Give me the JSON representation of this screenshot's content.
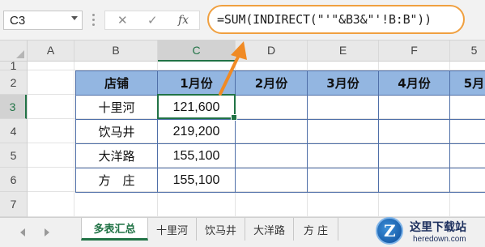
{
  "formula_bar": {
    "name_box": "C3",
    "cancel_icon": "✕",
    "enter_icon": "✓",
    "fx_label": "fx",
    "formula": "=SUM(INDIRECT(\"'\"&B3&\"'!B:B\"))"
  },
  "columns": [
    "A",
    "B",
    "C",
    "D",
    "E",
    "F",
    "5"
  ],
  "rows": [
    "1",
    "2",
    "3",
    "4",
    "5",
    "6",
    "7"
  ],
  "selected_cell": "C3",
  "table": {
    "headers": [
      "店铺",
      "1月份",
      "2月份",
      "3月份",
      "4月份",
      "5月"
    ],
    "rows": [
      {
        "store": "十里河",
        "jan": "121,600"
      },
      {
        "store": "饮马井",
        "jan": "219,200"
      },
      {
        "store": "大洋路",
        "jan": "155,100"
      },
      {
        "store": "方　庄",
        "jan": "155,100"
      }
    ]
  },
  "sheet_tabs": [
    {
      "label": "多表汇总",
      "active": true
    },
    {
      "label": "十里河",
      "active": false
    },
    {
      "label": "饮马井",
      "active": false
    },
    {
      "label": "大洋路",
      "active": false
    },
    {
      "label": "方 庄",
      "active": false
    }
  ],
  "watermark": {
    "title": "这里下载站",
    "url": "heredown.com",
    "logo_letter": "Z"
  },
  "colors": {
    "accent_green": "#217346",
    "header_fill": "#93b6e1",
    "table_border": "#4f6fa8",
    "callout_orange": "#f0a040"
  },
  "icons": {
    "name_box_dropdown": "chevron-down-icon",
    "formula_dots": "dots-icon",
    "cancel": "cancel-icon",
    "enter": "check-icon",
    "function": "fx-icon"
  }
}
